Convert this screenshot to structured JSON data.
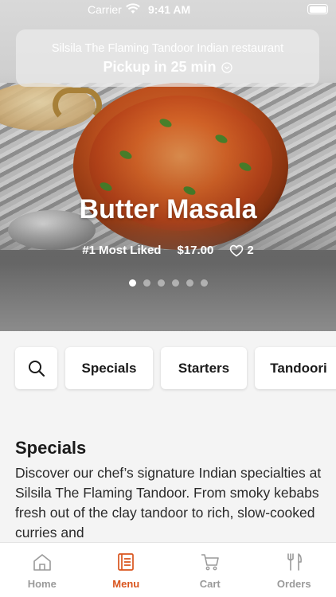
{
  "status_bar": {
    "carrier": "Carrier",
    "time": "9:41 AM"
  },
  "banner": {
    "restaurant_name": "Silsila The Flaming Tandoor Indian restaurant",
    "pickup": "Pickup in 25 min"
  },
  "hero": {
    "dish_name": "Butter Masala",
    "rank": "#1 Most Liked",
    "price": "$17.00",
    "likes": "2",
    "carousel_count": 6,
    "carousel_active": 0
  },
  "categories": [
    {
      "label": "Specials"
    },
    {
      "label": "Starters"
    },
    {
      "label": "Tandoori"
    }
  ],
  "section": {
    "title": "Specials",
    "description": "Discover our chef’s signature Indian specialties at Silsila The Flaming Tandoor. From smoky kebabs fresh out of the clay tandoor to rich, slow-cooked curries and"
  },
  "tabs": [
    {
      "label": "Home",
      "icon": "home-icon"
    },
    {
      "label": "Menu",
      "icon": "menu-icon",
      "active": true
    },
    {
      "label": "Cart",
      "icon": "cart-icon"
    },
    {
      "label": "Orders",
      "icon": "fork-knife-icon"
    }
  ],
  "colors": {
    "accent": "#d9541d",
    "inactive_tab": "#9a9a9a",
    "background": "#f4f4f4"
  }
}
